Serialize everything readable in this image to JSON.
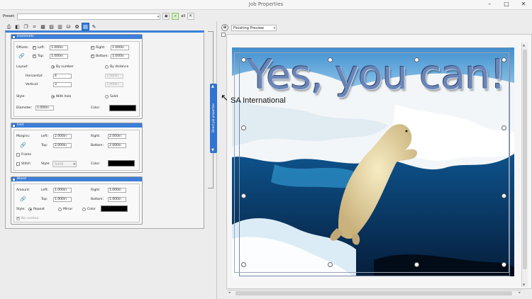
{
  "window": {
    "title": "Job Properties",
    "minimize": "–",
    "maximize": "□",
    "close": "✕"
  },
  "preset": {
    "label": "Preset:",
    "value": "",
    "all_label": "all"
  },
  "toolbar": {
    "icons": [
      "print-icon",
      "layers-icon",
      "copy-icon",
      "crop-icon",
      "grid-icon",
      "image-icon",
      "panel-icon",
      "bucket-icon",
      "color-icon",
      "tile-icon",
      "check-icon"
    ]
  },
  "grommets": {
    "header": "Grommets",
    "offsets_label": "Offsets:",
    "left_label": "Left:",
    "left_value": "1.000in",
    "right_label": "Right:",
    "right_value": "1.000in",
    "top_label": "Top:",
    "top_value": "1.000in",
    "bottom_label": "Bottom:",
    "bottom_value": "1.000in",
    "layout_label": "Layout:",
    "by_number": "By number",
    "by_distance": "By distance",
    "horizontal_label": "Horizontal:",
    "horizontal_value": "4",
    "horizontal_dist": "1.000in",
    "vertical_label": "Vertical:",
    "vertical_value": "3",
    "vertical_dist": "1.000in",
    "style_label": "Style:",
    "with_hole": "With hole",
    "solid": "Solid",
    "diameter_label": "Diameter:",
    "diameter_value": "1.000in",
    "color_label": "Color:"
  },
  "fold": {
    "header": "Fold",
    "margins_label": "Margins:",
    "left_label": "Left:",
    "left_value": "2.000in",
    "right_label": "Right:",
    "right_value": "2.000in",
    "top_label": "Top:",
    "top_value": "2.000in",
    "bottom_label": "Bottom:",
    "bottom_value": "2.000in",
    "frame_label": "Frame",
    "stitch_label": "Stitch",
    "style_label": "Style:",
    "style_value": "Solid",
    "color_label": "Color:"
  },
  "bleed": {
    "header": "Bleed",
    "amount_label": "Amount:",
    "left_label": "Left:",
    "left_value": "1.000in",
    "right_label": "Right:",
    "right_value": "1.000in",
    "top_label": "Top:",
    "top_value": "1.000in",
    "bottom_label": "Bottom:",
    "bottom_value": "1.000in",
    "style_label": "Style:",
    "repeat": "Repeat",
    "mirror": "Mirror",
    "color": "Color",
    "no_contour": "No contour"
  },
  "side_tab": {
    "label": "Direct job properties"
  },
  "preview": {
    "mode": "Finishing Preview",
    "headline": "Yes, you can!",
    "tooltip": "SA International"
  },
  "colors": {
    "accent": "#3b7fd9",
    "swatch": "#000000"
  }
}
